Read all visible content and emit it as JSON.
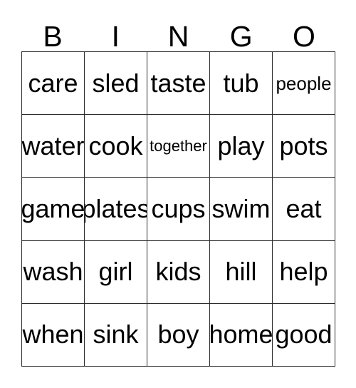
{
  "card": {
    "title": "BINGO",
    "header_letters": [
      "B",
      "I",
      "N",
      "G",
      "O"
    ],
    "grid_rows": 5,
    "grid_columns": 5,
    "colors": {
      "background": "#ffffff",
      "text": "#000000",
      "border": "#2b2b2b"
    },
    "cells": [
      [
        {
          "label": "care",
          "size": "normal"
        },
        {
          "label": "sled",
          "size": "normal"
        },
        {
          "label": "taste",
          "size": "normal"
        },
        {
          "label": "tub",
          "size": "normal"
        },
        {
          "label": "people",
          "size": "small"
        }
      ],
      [
        {
          "label": "water",
          "size": "normal"
        },
        {
          "label": "cook",
          "size": "normal"
        },
        {
          "label": "together",
          "size": "xsmall"
        },
        {
          "label": "play",
          "size": "normal"
        },
        {
          "label": "pots",
          "size": "normal"
        }
      ],
      [
        {
          "label": "game",
          "size": "normal"
        },
        {
          "label": "plates",
          "size": "normal"
        },
        {
          "label": "cups",
          "size": "normal"
        },
        {
          "label": "swim",
          "size": "normal"
        },
        {
          "label": "eat",
          "size": "normal"
        }
      ],
      [
        {
          "label": "wash",
          "size": "normal"
        },
        {
          "label": "girl",
          "size": "normal"
        },
        {
          "label": "kids",
          "size": "normal"
        },
        {
          "label": "hill",
          "size": "normal"
        },
        {
          "label": "help",
          "size": "normal"
        }
      ],
      [
        {
          "label": "when",
          "size": "normal"
        },
        {
          "label": "sink",
          "size": "normal"
        },
        {
          "label": "boy",
          "size": "normal"
        },
        {
          "label": "home",
          "size": "normal"
        },
        {
          "label": "good",
          "size": "normal"
        }
      ]
    ]
  }
}
